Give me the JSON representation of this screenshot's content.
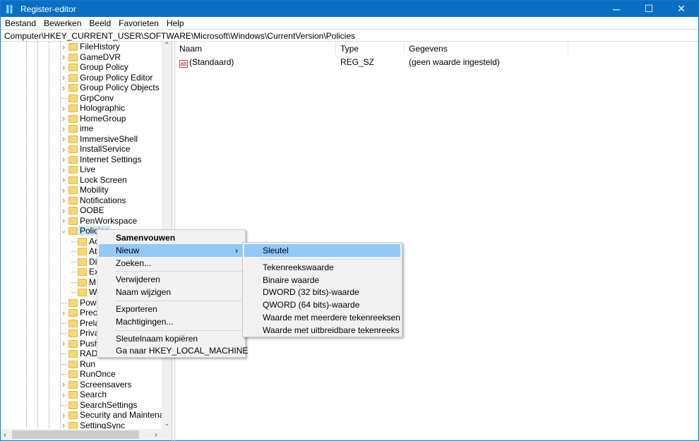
{
  "window": {
    "title": "Register-editor",
    "controls": [
      "─",
      "☐",
      "✕"
    ]
  },
  "menubar": [
    "Bestand",
    "Bewerken",
    "Beeld",
    "Favorieten",
    "Help"
  ],
  "address": "Computer\\HKEY_CURRENT_USER\\SOFTWARE\\Microsoft\\Windows\\CurrentVersion\\Policies",
  "tree": [
    {
      "label": "FileHistory",
      "exp": true,
      "lvl": 0
    },
    {
      "label": "GameDVR",
      "exp": true,
      "lvl": 0
    },
    {
      "label": "Group Policy",
      "exp": true,
      "lvl": 0
    },
    {
      "label": "Group Policy Editor",
      "exp": true,
      "lvl": 0
    },
    {
      "label": "Group Policy Objects",
      "exp": true,
      "lvl": 0
    },
    {
      "label": "GrpConv",
      "exp": false,
      "lvl": 0
    },
    {
      "label": "Holographic",
      "exp": true,
      "lvl": 0
    },
    {
      "label": "HomeGroup",
      "exp": true,
      "lvl": 0
    },
    {
      "label": "ime",
      "exp": true,
      "lvl": 0
    },
    {
      "label": "ImmersiveShell",
      "exp": true,
      "lvl": 0
    },
    {
      "label": "InstallService",
      "exp": true,
      "lvl": 0
    },
    {
      "label": "Internet Settings",
      "exp": true,
      "lvl": 0
    },
    {
      "label": "Live",
      "exp": true,
      "lvl": 0
    },
    {
      "label": "Lock Screen",
      "exp": true,
      "lvl": 0
    },
    {
      "label": "Mobility",
      "exp": true,
      "lvl": 0
    },
    {
      "label": "Notifications",
      "exp": true,
      "lvl": 0
    },
    {
      "label": "OOBE",
      "exp": true,
      "lvl": 0
    },
    {
      "label": "PenWorkspace",
      "exp": true,
      "lvl": 0
    },
    {
      "label": "Policies",
      "exp": true,
      "open": true,
      "sel": true,
      "lvl": 0
    },
    {
      "label": "Ac",
      "exp": false,
      "lvl": 1
    },
    {
      "label": "At",
      "exp": false,
      "lvl": 1
    },
    {
      "label": "Di",
      "exp": false,
      "lvl": 1
    },
    {
      "label": "Ex",
      "exp": false,
      "lvl": 1
    },
    {
      "label": "M",
      "exp": false,
      "lvl": 1
    },
    {
      "label": "W",
      "exp": false,
      "lvl": 1
    },
    {
      "label": "Powe",
      "exp": false,
      "lvl": 0
    },
    {
      "label": "Precis",
      "exp": true,
      "lvl": 0
    },
    {
      "label": "Prelau",
      "exp": false,
      "lvl": 0
    },
    {
      "label": "Privac",
      "exp": false,
      "lvl": 0
    },
    {
      "label": "PushN",
      "exp": true,
      "lvl": 0
    },
    {
      "label": "RADA",
      "exp": false,
      "lvl": 0
    },
    {
      "label": "Run",
      "exp": false,
      "lvl": 0
    },
    {
      "label": "RunOnce",
      "exp": false,
      "lvl": 0
    },
    {
      "label": "Screensavers",
      "exp": true,
      "lvl": 0
    },
    {
      "label": "Search",
      "exp": true,
      "lvl": 0
    },
    {
      "label": "SearchSettings",
      "exp": false,
      "lvl": 0
    },
    {
      "label": "Security and Maintenance",
      "exp": true,
      "lvl": 0
    },
    {
      "label": "SettingSync",
      "exp": true,
      "lvl": 0
    }
  ],
  "columns": {
    "name": "Naam",
    "type": "Type",
    "data": "Gegevens"
  },
  "values": [
    {
      "name": "(Standaard)",
      "type": "REG_SZ",
      "data": "(geen waarde ingesteld)",
      "icon": "ab"
    }
  ],
  "context_menu": [
    {
      "label": "Samenvouwen",
      "bold": true
    },
    {
      "label": "Nieuw",
      "hl": true,
      "sub": true
    },
    {
      "label": "Zoeken..."
    },
    {
      "sep": true
    },
    {
      "label": "Verwijderen"
    },
    {
      "label": "Naam wijzigen"
    },
    {
      "sep": true
    },
    {
      "label": "Exporteren"
    },
    {
      "label": "Machtigingen..."
    },
    {
      "sep": true
    },
    {
      "label": "Sleutelnaam kopiëren"
    },
    {
      "label": "Ga naar HKEY_LOCAL_MACHINE"
    }
  ],
  "submenu": [
    {
      "label": "Sleutel",
      "hl": true
    },
    {
      "sep": true
    },
    {
      "label": "Tekenreekswaarde"
    },
    {
      "label": "Binaire waarde"
    },
    {
      "label": "DWORD (32 bits)-waarde"
    },
    {
      "label": "QWORD (64 bits)-waarde"
    },
    {
      "label": "Waarde met meerdere tekenreeksen"
    },
    {
      "label": "Waarde met uitbreidbare tekenreeks"
    }
  ],
  "colors": {
    "titlebar": "#0a6fc2",
    "highlight": "#91c9f7",
    "selection": "#cce8ff"
  }
}
